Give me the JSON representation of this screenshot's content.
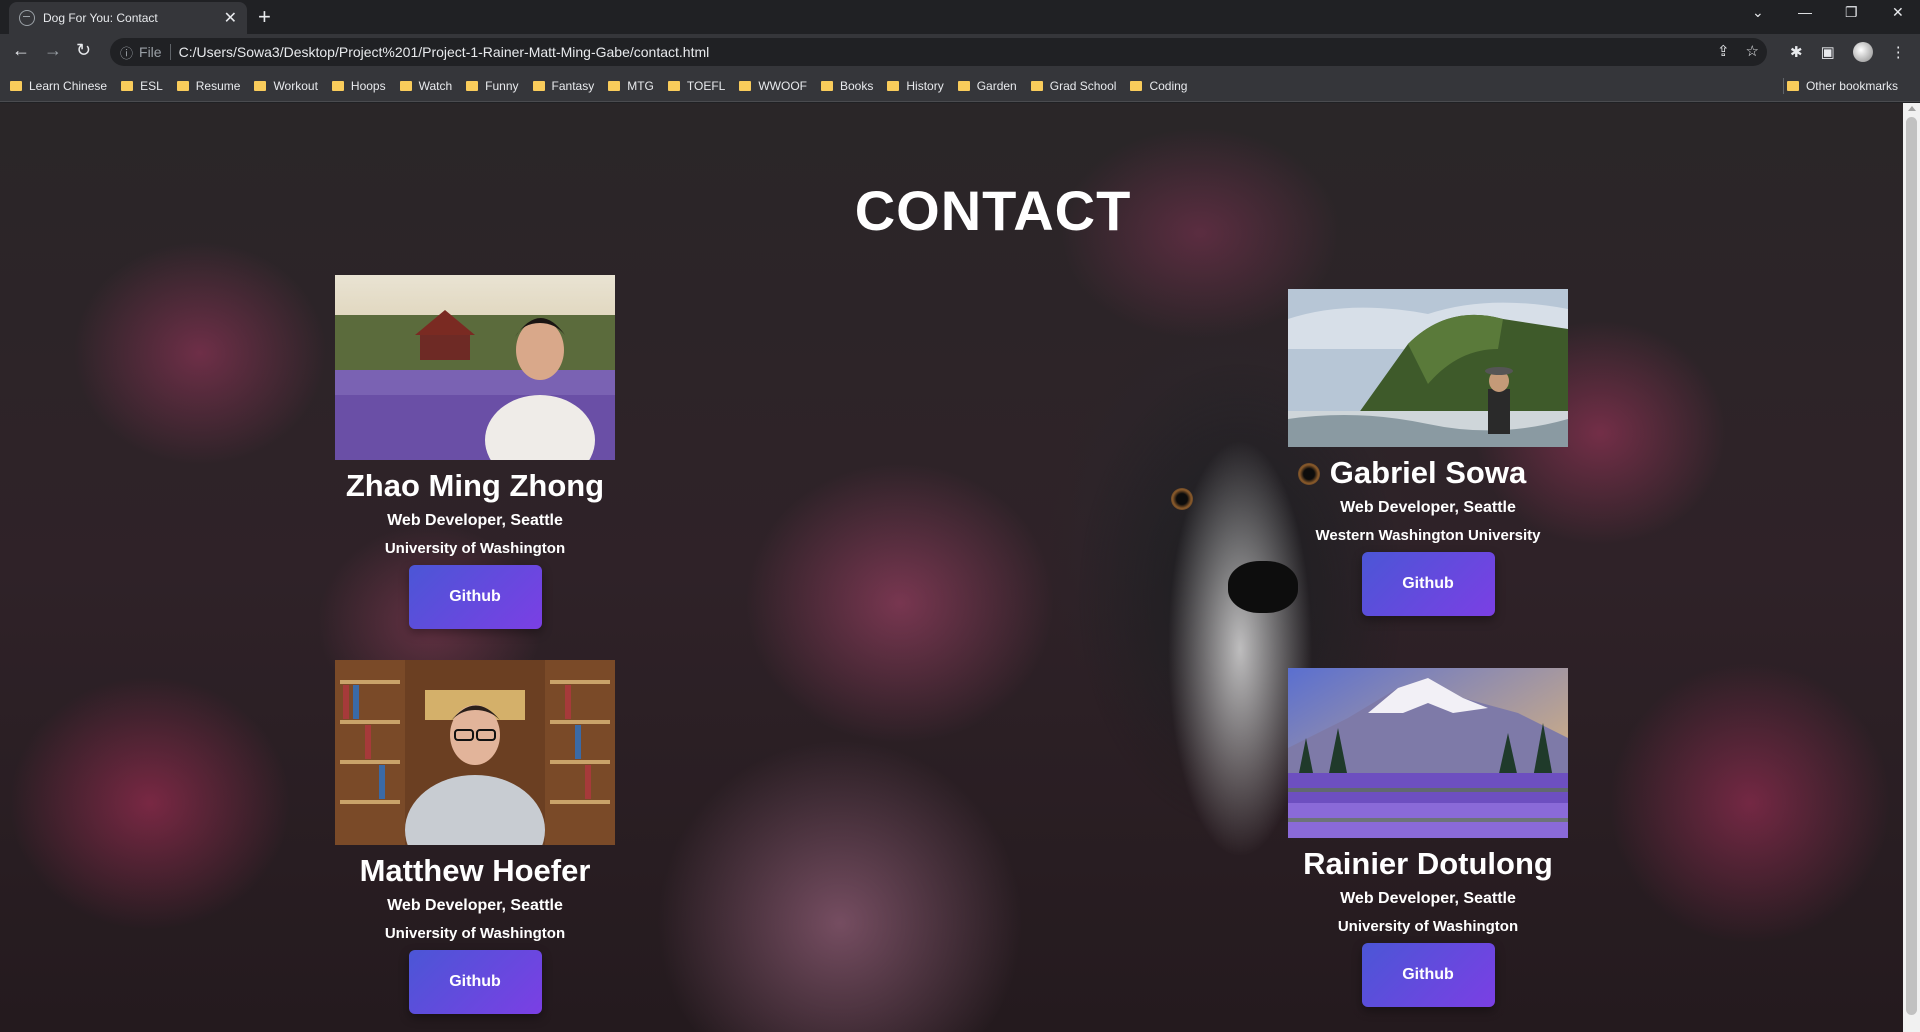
{
  "browser": {
    "tab_title": "Dog For You: Contact",
    "url_scheme": "File",
    "url": "C:/Users/Sowa3/Desktop/Project%201/Project-1-Rainer-Matt-Ming-Gabe/contact.html",
    "bookmarks": [
      "Learn Chinese",
      "ESL",
      "Resume",
      "Workout",
      "Hoops",
      "Watch",
      "Funny",
      "Fantasy",
      "MTG",
      "TOEFL",
      "WWOOF",
      "Books",
      "History",
      "Garden",
      "Grad School",
      "Coding"
    ],
    "other_bookmarks": "Other bookmarks"
  },
  "page": {
    "title": "CONTACT"
  },
  "contacts": [
    {
      "name": "Zhao Ming Zhong",
      "role": "Web Developer, Seattle",
      "school": "University of Washington",
      "button": "Github"
    },
    {
      "name": "Matthew Hoefer",
      "role": "Web Developer, Seattle",
      "school": "University of Washington",
      "button": "Github"
    },
    {
      "name": "Gabriel Sowa",
      "role": "Web Developer, Seattle",
      "school": "Western Washington University",
      "button": "Github"
    },
    {
      "name": "Rainier Dotulong",
      "role": "Web Developer, Seattle",
      "school": "University of Washington",
      "button": "Github"
    }
  ],
  "colors": {
    "button_gradient_start": "#4b56d6",
    "button_gradient_end": "#7b3fe4",
    "bookmark_folder": "#f9cc5b"
  }
}
